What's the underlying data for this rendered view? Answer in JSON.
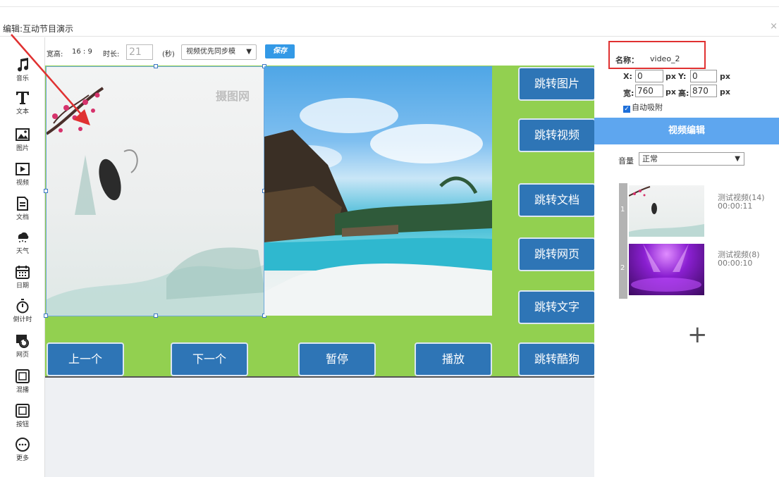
{
  "title": "编辑:互动节目演示",
  "close": "×",
  "tools": [
    {
      "name": "music",
      "label": "音乐"
    },
    {
      "name": "text",
      "label": "文本"
    },
    {
      "name": "image",
      "label": "图片"
    },
    {
      "name": "video",
      "label": "视频"
    },
    {
      "name": "document",
      "label": "文档"
    },
    {
      "name": "weather",
      "label": "天气"
    },
    {
      "name": "date",
      "label": "日期"
    },
    {
      "name": "countdown",
      "label": "倒计时"
    },
    {
      "name": "webpage",
      "label": "网页"
    },
    {
      "name": "carousel",
      "label": "混播"
    },
    {
      "name": "button",
      "label": "按钮"
    },
    {
      "name": "more",
      "label": "更多"
    }
  ],
  "toolbar": {
    "aspect_label": "宽高:",
    "aspect_value": "16 : 9",
    "duration_label": "时长:",
    "duration_value": "21",
    "seconds_label": "(秒)",
    "mode_value": "视频优先同步模",
    "save_label": "保存"
  },
  "stage": {
    "watermark": "摄图网",
    "buttons": {
      "jump_image": "跳转图片",
      "jump_video": "跳转视频",
      "jump_doc": "跳转文档",
      "jump_web": "跳转网页",
      "jump_text": "跳转文字",
      "jump_kugou": "跳转酷狗",
      "prev": "上一个",
      "next": "下一个",
      "pause": "暂停",
      "play": "播放"
    }
  },
  "props": {
    "name_label": "名称：",
    "name_value": "video_2",
    "x_label": "X:",
    "x_value": "0",
    "y_label": "Y:",
    "y_value": "0",
    "px": "px",
    "w_label": "宽:",
    "w_value": "760",
    "h_label": "高:",
    "h_value": "870",
    "auto_snap": "自动吸附",
    "auto_snap_checked": true
  },
  "video_edit": {
    "header": "视频编辑",
    "volume_label": "音量",
    "volume_value": "正常",
    "playlist": [
      {
        "index": "1",
        "name": "测试视频(14)",
        "duration": "00:00:11"
      },
      {
        "index": "2",
        "name": "测试视频(8)",
        "duration": "00:00:10"
      }
    ],
    "add_label": "+"
  },
  "colors": {
    "stage_green": "#92d050",
    "button_blue": "#2e75b6",
    "accent_blue": "#5ea6ef",
    "highlight_red": "#e03131"
  }
}
